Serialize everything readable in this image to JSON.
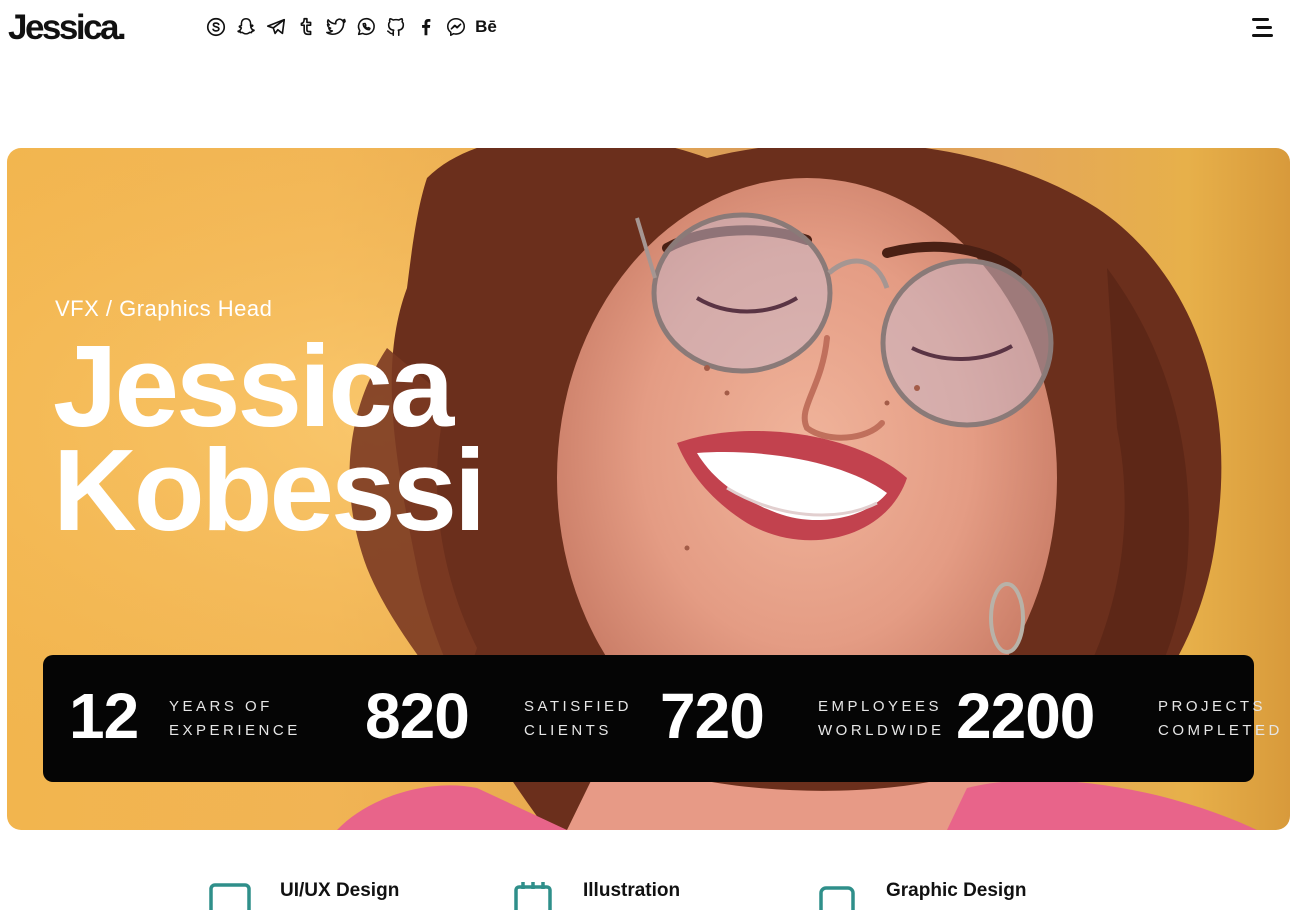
{
  "header": {
    "logo": "Jessica.",
    "socials": [
      {
        "name": "skype-icon"
      },
      {
        "name": "snapchat-icon"
      },
      {
        "name": "telegram-icon"
      },
      {
        "name": "tumblr-icon"
      },
      {
        "name": "twitter-icon"
      },
      {
        "name": "whatsapp-icon"
      },
      {
        "name": "github-icon"
      },
      {
        "name": "facebook-icon"
      },
      {
        "name": "messenger-icon"
      },
      {
        "name": "behance-icon",
        "label": "Bē"
      }
    ],
    "menu_icon": "hamburger-menu-icon"
  },
  "hero": {
    "subtitle": "VFX / Graphics Head",
    "first_name": "Jessica",
    "last_name": "Kobessi",
    "stats": [
      {
        "value": "12",
        "line1": "YEARS OF",
        "line2": "EXPERIENCE"
      },
      {
        "value": "820",
        "line1": "SATISFIED",
        "line2": "CLIENTS"
      },
      {
        "value": "720",
        "line1": "EMPLOYEES",
        "line2": "WORLDWIDE"
      },
      {
        "value": "2200",
        "line1": "PROJECTS",
        "line2": "COMPLETED"
      }
    ]
  },
  "services": [
    {
      "title": "UI/UX Design",
      "icon": "monitor-icon"
    },
    {
      "title": "Illustration",
      "icon": "calendar-icon"
    },
    {
      "title": "Graphic Design",
      "icon": "monitor-icon"
    }
  ],
  "colors": {
    "accent": "#2f8f8a",
    "stats_bg": "#050505",
    "hero_bg": "#f1b454"
  }
}
